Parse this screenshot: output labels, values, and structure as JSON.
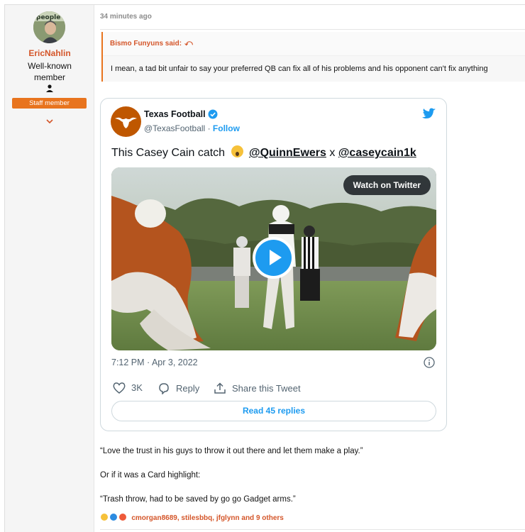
{
  "user": {
    "name": "EricNahlin",
    "title_line1": "Well-known",
    "title_line2": "member",
    "badge": "Staff member",
    "icons": {
      "avatar": "avatar-photo",
      "role": "user-role-icon",
      "expand": "chevron-down-icon"
    }
  },
  "post": {
    "timestamp": "34 minutes ago",
    "quote": {
      "author": "Bismo Funyuns said:",
      "arrow": "⤺",
      "text": "I mean, a tad bit unfair to say your preferred QB can fix all of his problems and his opponent can't fix anything"
    },
    "tweet": {
      "display_name": "Texas Football",
      "handle": "@TexasFootball",
      "separator": "·",
      "follow": "Follow",
      "text_prefix": "This Casey Cain catch",
      "mention1": "@QuinnEwers",
      "joiner": "x",
      "mention2": "@caseycain1k",
      "watch_label": "Watch on Twitter",
      "date": "7:12 PM · Apr 3, 2022",
      "likes": "3K",
      "reply_label": "Reply",
      "share_label": "Share this Tweet",
      "replies_button": "Read 45 replies",
      "colors": {
        "brand": "#bf5700",
        "accent": "#1d9bf0"
      }
    },
    "messages": [
      "“Love the trust in his guys to throw it out there and let them make a play.”",
      "Or if it was a Card highlight:",
      "“Trash throw, had to be saved by go go Gadget arms.”"
    ],
    "reactions": {
      "people": "cmorgan8689, stilesbbq, jfglynn and 9 others",
      "icons": [
        "laugh-emoji-icon",
        "like-icon",
        "love-emoji-icon"
      ]
    }
  },
  "colors": {
    "link_orange": "#d4562a",
    "badge_orange": "#e8741e"
  }
}
